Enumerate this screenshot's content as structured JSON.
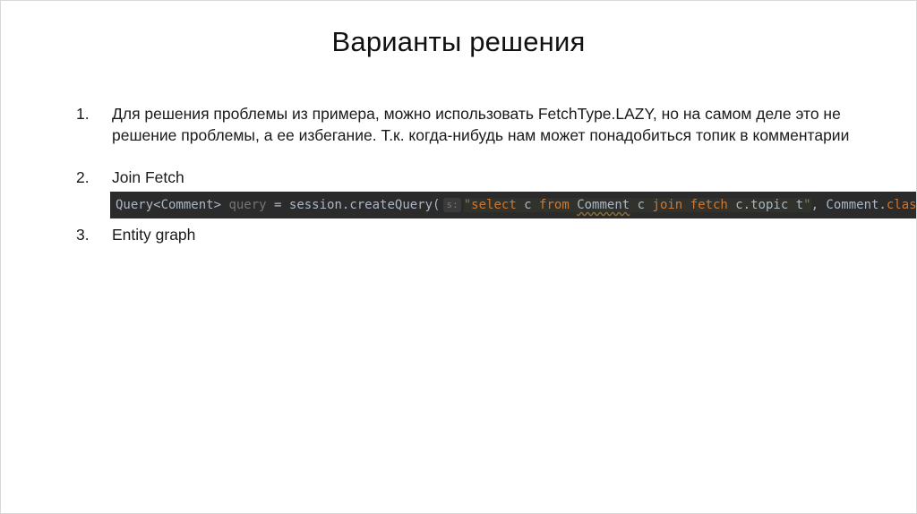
{
  "slide": {
    "title": "Варианты решения",
    "items": [
      {
        "number": "1.",
        "text": "Для решения проблемы из примера, можно использовать FetchType.LAZY, но на самом деле это не решение проблемы, а ее избегание. Т.к. когда-нибудь нам может понадобиться топик в комментарии"
      },
      {
        "number": "2.",
        "text": "Join Fetch"
      },
      {
        "number": "3.",
        "text": "Entity graph"
      }
    ],
    "code": {
      "type_decl": "Query<Comment>",
      "var_name": "query",
      "assign": " = session.createQuery(",
      "param_hint": "s:",
      "str_open": "\"",
      "kw_select": "select",
      "s_c1": " c ",
      "kw_from": "from",
      "s_sp1": " ",
      "entity": "Comment",
      "s_c2": " c ",
      "kw_join": "join",
      "s_sp2": " ",
      "kw_fetch": "fetch",
      "s_tail": " c.topic t",
      "str_close": "\"",
      "after_str": ", Comment.",
      "class_kw": "class",
      "end": ");"
    },
    "colors": {
      "code_background": "#2b2b2b",
      "code_string": "#6a8759",
      "code_keyword": "#cc7832",
      "code_text": "#a9b7c6"
    }
  }
}
